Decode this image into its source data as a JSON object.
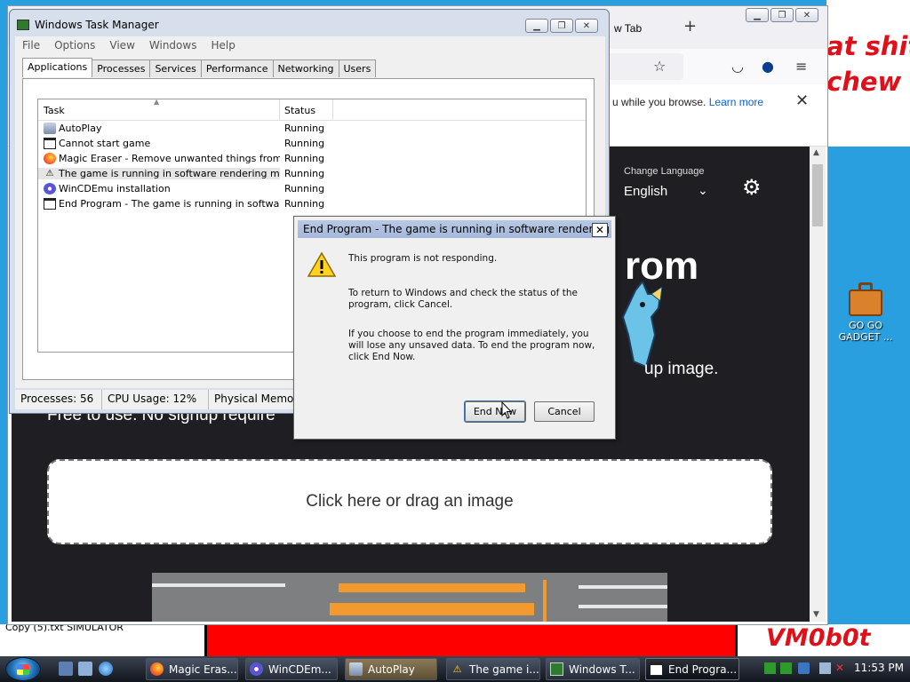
{
  "desktop": {
    "wall_text": "at shit\nchew",
    "corner_label": "Copy (5).txt   SIMULATOR",
    "vm_label": "VM0b0t",
    "icon": {
      "name": "briefcase-icon",
      "label": "GO GO\nGADGET ..."
    }
  },
  "browser": {
    "tab_title": "w Tab",
    "notice_text": "u while you browse.",
    "notice_link": "Learn more",
    "language_caption": "Change Language",
    "language_value": "English",
    "hero_big": "rom",
    "hero_sub": "up image.",
    "hero_free": "Free to use. No signup require",
    "drop_zone": "Click here or drag an image"
  },
  "task_manager": {
    "title": "Windows Task Manager",
    "menu": [
      "File",
      "Options",
      "View",
      "Windows",
      "Help"
    ],
    "tabs": [
      "Applications",
      "Processes",
      "Services",
      "Performance",
      "Networking",
      "Users"
    ],
    "active_tab": "Applications",
    "columns": {
      "task": "Task",
      "status": "Status"
    },
    "rows": [
      {
        "icon": "autoplay-icon",
        "task": "AutoPlay",
        "status": "Running"
      },
      {
        "icon": "window-icon",
        "task": "Cannot start game",
        "status": "Running"
      },
      {
        "icon": "firefox-icon",
        "task": "Magic Eraser - Remove unwanted things from im...",
        "status": "Running"
      },
      {
        "icon": "warning-icon",
        "task": "The game is running in software rendering mode",
        "status": "Running",
        "selected": true
      },
      {
        "icon": "wincdemu-icon",
        "task": "WinCDEmu installation",
        "status": "Running"
      },
      {
        "icon": "window-icon",
        "task": "End Program - The game is running in software r...",
        "status": "Running"
      }
    ],
    "status_bar": {
      "processes": "Processes: 56",
      "cpu": "CPU Usage: 12%",
      "memory": "Physical Memory"
    }
  },
  "end_program": {
    "title": "End Program - The game is running in software rendering ...",
    "close": "✕",
    "line1": "This program is not responding.",
    "line2": "To return to Windows and check the status of the program, click Cancel.",
    "line3": "If you choose to end the program immediately, you will lose any unsaved data. To end the program now, click End Now.",
    "end_now": "End Now",
    "cancel": "Cancel"
  },
  "taskbar": {
    "buttons": [
      {
        "label": "Magic Eras...",
        "icon": "firefox-icon"
      },
      {
        "label": "WinCDEm...",
        "icon": "wincdemu-icon"
      },
      {
        "label": "AutoPlay",
        "icon": "autoplay-icon"
      },
      {
        "label": "The game i...",
        "icon": "warning-icon"
      },
      {
        "label": "Windows T...",
        "icon": "task-manager-icon"
      },
      {
        "label": "End Progra...",
        "icon": "window-icon"
      }
    ],
    "clock": "11:53 PM"
  },
  "colors": {
    "wallpaper_blue": "#2a9fe0",
    "wallpaper_red": "#ff0000",
    "page_dark": "#1f1f23",
    "link_blue": "#0060df"
  }
}
